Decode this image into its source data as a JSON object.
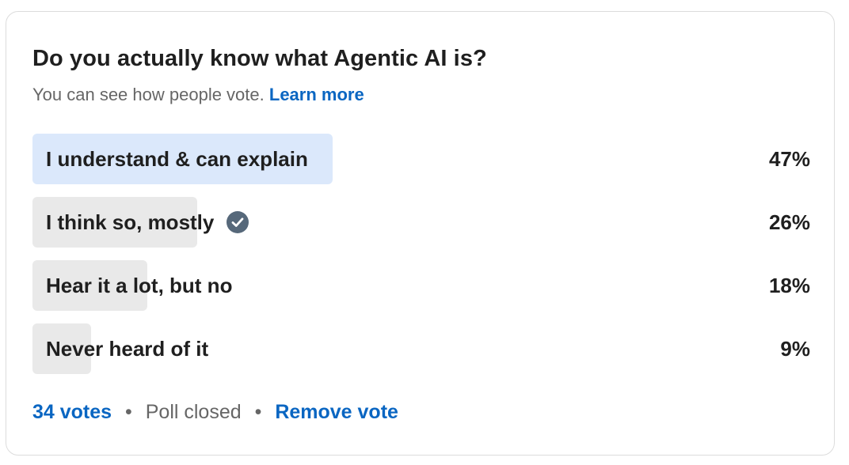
{
  "poll": {
    "question": "Do you actually know what Agentic AI is?",
    "visibility_text": "You can see how people vote.",
    "learn_more_label": "Learn more",
    "options": [
      {
        "label": "I understand & can explain",
        "percent_label": "47%",
        "percent": 47,
        "voted": false,
        "leading": true
      },
      {
        "label": "I think so, mostly",
        "percent_label": "26%",
        "percent": 26,
        "voted": true,
        "leading": false
      },
      {
        "label": "Hear it a lot, but no",
        "percent_label": "18%",
        "percent": 18,
        "voted": false,
        "leading": false
      },
      {
        "label": "Never heard of it",
        "percent_label": "9%",
        "percent": 9,
        "voted": false,
        "leading": false
      }
    ],
    "footer": {
      "votes_label": "34 votes",
      "separator": "•",
      "status": "Poll closed",
      "remove_vote_label": "Remove vote"
    }
  },
  "colors": {
    "accent": "#0a66c2",
    "leading_fill": "#dbe8fb",
    "option_fill": "#e9e9e9",
    "check_icon": "#56687a"
  },
  "icons": {
    "voted_marker": "check-circle-icon"
  }
}
